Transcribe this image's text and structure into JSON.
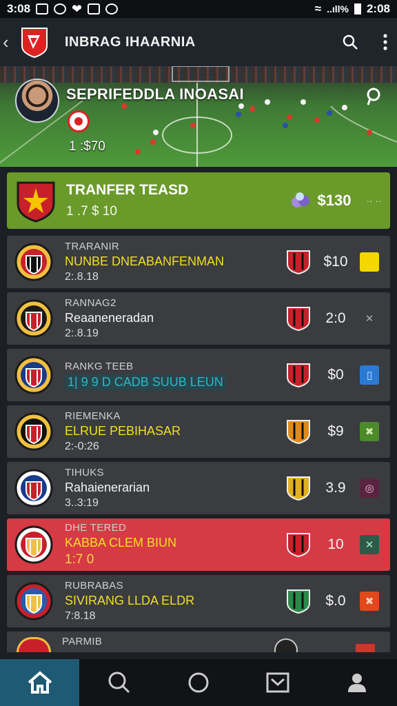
{
  "status_bar": {
    "time_left": "3:08",
    "time_right": "2:08",
    "battery": "..ıll%"
  },
  "app_bar": {
    "title": "INBRAG IHAARNIA"
  },
  "hero": {
    "title": "SEPRIFEDDLA INOASAI",
    "score": "1 :$70"
  },
  "featured": {
    "title": "TRANFER TEASD",
    "subtitle": "1 .7 $ 10",
    "price": "$130",
    "dots": "·· ··"
  },
  "rows": [
    {
      "category": "TRARANIR",
      "main": "NUNBE DNEABANFENMAN",
      "main_style": "yellow",
      "time": "2:.8.18",
      "value": "$10",
      "action_color": "#f4d600",
      "action_glyph": "■",
      "action_fg": "#f4d600"
    },
    {
      "category": "RANNAG2",
      "main": "Reaaneneradan",
      "main_style": "white",
      "time": "2:.8.19",
      "value": "2:0",
      "action_color": "transparent",
      "action_glyph": "✕",
      "action_fg": "#aaa"
    },
    {
      "category": "RANKG TEEB",
      "main": "1| 9  9  D  CADB SUUB LEUN",
      "main_style": "cyan",
      "time": "",
      "value": "$0",
      "action_color": "#2a7ad4",
      "action_glyph": "▯",
      "action_fg": "#cfe6ff"
    },
    {
      "category": "RIEMENKA",
      "main": "ELRUE PEBIHASAR",
      "main_style": "yellow",
      "time": "2:-0:26",
      "value": "$9",
      "action_color": "#4c8a2a",
      "action_glyph": "✖",
      "action_fg": "#cfe8b0"
    },
    {
      "category": "TIHUKS",
      "main": "Rahaienerarian",
      "main_style": "white",
      "time": "3..3:19",
      "value": "3.9",
      "action_color": "#5a2440",
      "action_glyph": "◎",
      "action_fg": "#f0c0d8"
    },
    {
      "category": "DHE TERED",
      "main": "KABBA CLEM BIUN",
      "main_style": "yellow",
      "time": "1:7 0",
      "value": "10",
      "action_color": "#2f5a4a",
      "action_glyph": "✕",
      "action_fg": "#9ff0c8"
    },
    {
      "category": "RUBRABAS",
      "main": "SIVIRANG LLDA ELDR",
      "main_style": "yellow",
      "time": "7:8.18",
      "value": "$.0",
      "action_color": "#e04a1a",
      "action_glyph": "✖",
      "action_fg": "#ffd0b8"
    }
  ],
  "partial_row": {
    "category": "PARMIB"
  },
  "colors": {
    "featured_bg": "#6a9a2a",
    "highlight_bg": "#d63a44",
    "nav_active": "#1e5a74"
  },
  "bottom_nav": [
    "home-icon",
    "search-icon",
    "circle-icon",
    "inbox-icon",
    "profile-icon"
  ]
}
